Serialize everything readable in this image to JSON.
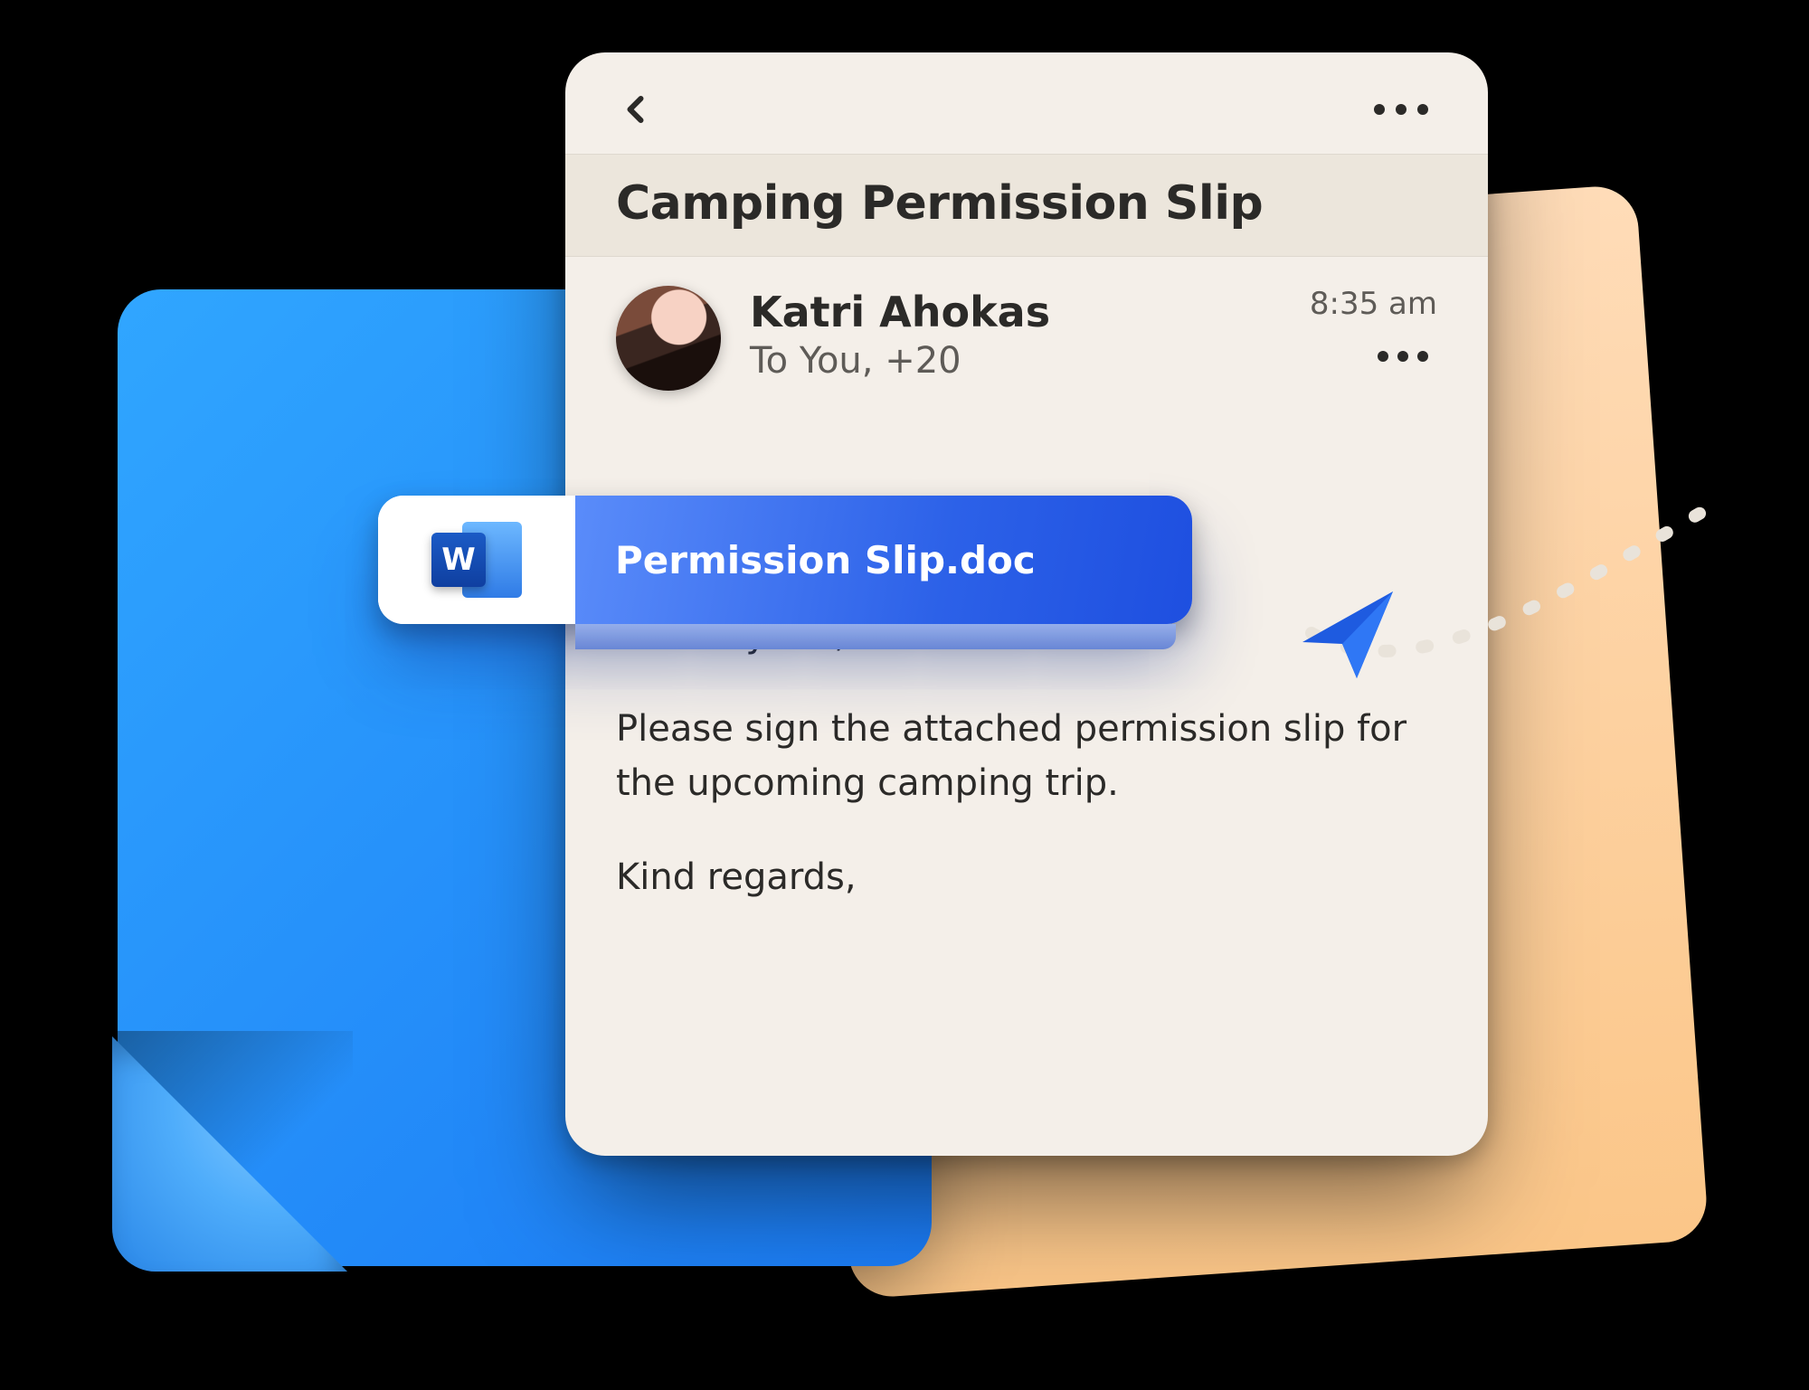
{
  "email": {
    "subject": "Camping Permission Slip",
    "sender": {
      "name": "Katri Ahokas",
      "to_line": "To You, +20"
    },
    "time": "8:35 am",
    "body": {
      "greeting": "Hi everyone,",
      "paragraph": "Please sign the attached permission slip for the upcoming camping trip.",
      "signoff": "Kind regards,"
    }
  },
  "attachment": {
    "filename": "Permission Slip.doc",
    "app_letter": "W"
  },
  "icons": {
    "back": "back",
    "more": "more",
    "send": "send"
  }
}
